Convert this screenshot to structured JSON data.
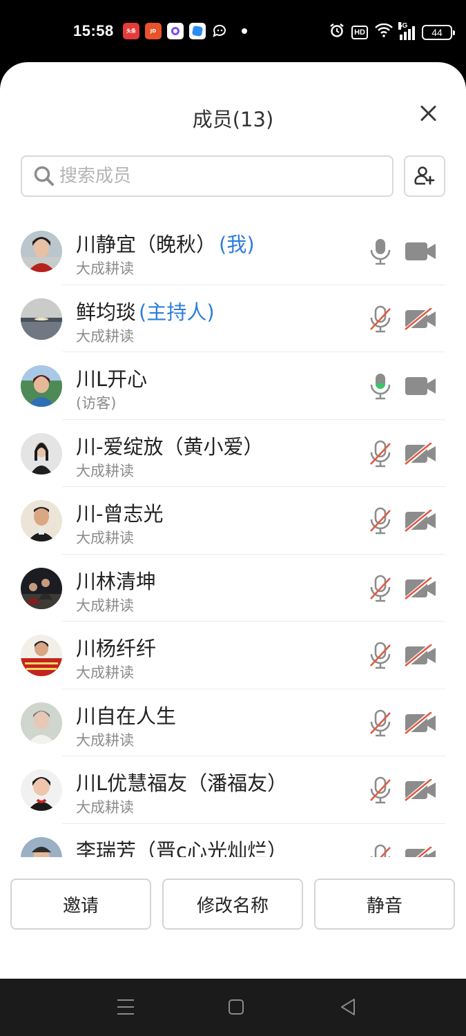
{
  "status_bar": {
    "time": "15:58",
    "app_icons": [
      {
        "name": "toutiao-icon",
        "label": "头条"
      },
      {
        "name": "jd-icon",
        "label": "JD"
      },
      {
        "name": "purple-app-icon",
        "label": ""
      },
      {
        "name": "blue-app-icon",
        "label": ""
      },
      {
        "name": "chat-icon",
        "label": ""
      }
    ],
    "indicators": [
      "alarm-icon",
      "hd-icon",
      "wifi-icon",
      "5g-signal-icon"
    ],
    "hd_label": "HD",
    "network_label": "5G",
    "battery": "44"
  },
  "sheet": {
    "title": "成员(13)"
  },
  "search": {
    "placeholder": "搜索成员"
  },
  "members": [
    {
      "name": "川静宜（晚秋）",
      "role": "(我)",
      "org": "大成耕读",
      "mic": "on",
      "cam": "on",
      "avatar": "woman-red-scarf"
    },
    {
      "name": "鲜均琰",
      "role": "(主持人)",
      "org": "大成耕读",
      "mic": "off",
      "cam": "off",
      "avatar": "lake-sunset"
    },
    {
      "name": "川L开心",
      "role": "",
      "org": "(访客)",
      "mic": "speaking",
      "cam": "on",
      "avatar": "woman-garden"
    },
    {
      "name": "川-爱绽放（黄小爱）",
      "role": "",
      "org": "大成耕读",
      "mic": "off",
      "cam": "off",
      "avatar": "woman-dark-hair"
    },
    {
      "name": "川-曾志光",
      "role": "",
      "org": "大成耕读",
      "mic": "off",
      "cam": "off",
      "avatar": "man-portrait"
    },
    {
      "name": "川林清坤",
      "role": "",
      "org": "大成耕读",
      "mic": "off",
      "cam": "off",
      "avatar": "group-photo"
    },
    {
      "name": "川杨纤纤",
      "role": "",
      "org": "大成耕读",
      "mic": "off",
      "cam": "off",
      "avatar": "woman-red-banner"
    },
    {
      "name": "川自在人生",
      "role": "",
      "org": "大成耕读",
      "mic": "off",
      "cam": "off",
      "avatar": "elder-woman"
    },
    {
      "name": "川L优慧福友（潘福友）",
      "role": "",
      "org": "大成耕读",
      "mic": "off",
      "cam": "off",
      "avatar": "woman-smiling"
    },
    {
      "name": "李瑞芳（晋c心光灿烂）",
      "role": "",
      "org": "",
      "mic": "off",
      "cam": "off",
      "avatar": "woman-cap"
    }
  ],
  "actions": {
    "invite": "邀请",
    "rename": "修改名称",
    "mute": "静音"
  },
  "colors": {
    "accent_blue": "#2f7ddb",
    "muted_red": "#e05a44",
    "speaking_green": "#3ac569",
    "icon_gray": "#8c8c8c"
  }
}
